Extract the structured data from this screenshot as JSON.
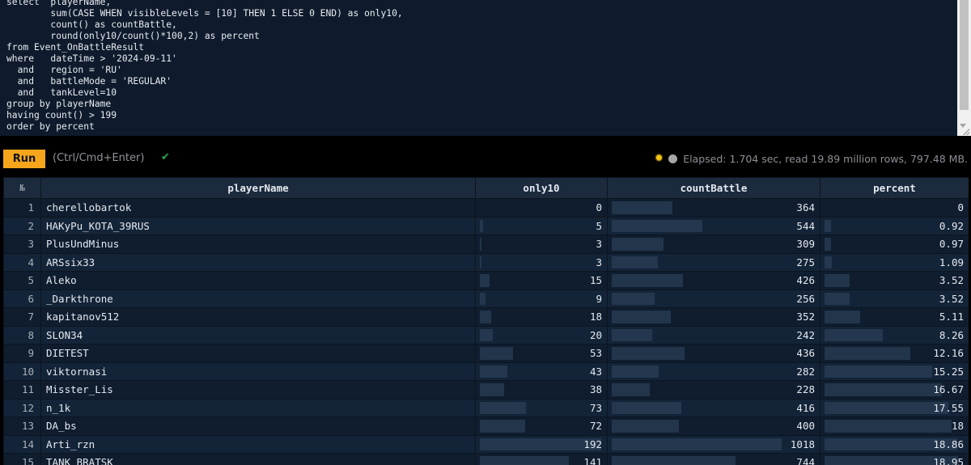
{
  "query": {
    "lines": [
      "select  playerName,",
      "        sum(CASE WHEN visibleLevels = [10] THEN 1 ELSE 0 END) as only10,",
      "        count() as countBattle,",
      "        round(only10/count()*100,2) as percent",
      "from Event_OnBattleResult",
      "where   dateTime > '2024-09-11'",
      "  and   region = 'RU'",
      "  and   battleMode = 'REGULAR'",
      "  and   tankLevel=10",
      "group by playerName",
      "having count() > 199",
      "order by percent"
    ]
  },
  "toolbar": {
    "run_label": "Run",
    "shortcut_hint": "(Ctrl/Cmd+Enter)",
    "check_icon": "checkmark-icon",
    "status_text": "Elapsed: 1.704 sec, read 19.89 million rows, 797.48 MB."
  },
  "icons": {
    "sun": "sun-icon",
    "dot": "status-dot-icon",
    "check": "checkmark-icon"
  },
  "colors": {
    "run_button": "#f7a61c",
    "check": "#2fa84f",
    "sun": "#f2c30f"
  },
  "results": {
    "columns": [
      "№",
      "playerName",
      "only10",
      "countBattle",
      "percent"
    ],
    "rows": [
      {
        "n": "1",
        "playerName": "cherellobartok",
        "only10": "0",
        "countBattle": "364",
        "percent": "0"
      },
      {
        "n": "2",
        "playerName": "HAKyPu_KOTA_39RUS",
        "only10": "5",
        "countBattle": "544",
        "percent": "0.92"
      },
      {
        "n": "3",
        "playerName": "PlusUndMinus",
        "only10": "3",
        "countBattle": "309",
        "percent": "0.97"
      },
      {
        "n": "4",
        "playerName": "ARSsix33",
        "only10": "3",
        "countBattle": "275",
        "percent": "1.09"
      },
      {
        "n": "5",
        "playerName": "Aleko",
        "only10": "15",
        "countBattle": "426",
        "percent": "3.52"
      },
      {
        "n": "6",
        "playerName": "_Darkthrone",
        "only10": "9",
        "countBattle": "256",
        "percent": "3.52"
      },
      {
        "n": "7",
        "playerName": "kapitanov512",
        "only10": "18",
        "countBattle": "352",
        "percent": "5.11"
      },
      {
        "n": "8",
        "playerName": "SLON34",
        "only10": "20",
        "countBattle": "242",
        "percent": "8.26"
      },
      {
        "n": "9",
        "playerName": "DIETEST",
        "only10": "53",
        "countBattle": "436",
        "percent": "12.16"
      },
      {
        "n": "10",
        "playerName": "viktornasi",
        "only10": "43",
        "countBattle": "282",
        "percent": "15.25"
      },
      {
        "n": "11",
        "playerName": "Misster_Lis",
        "only10": "38",
        "countBattle": "228",
        "percent": "16.67"
      },
      {
        "n": "12",
        "playerName": "n_1k",
        "only10": "73",
        "countBattle": "416",
        "percent": "17.55"
      },
      {
        "n": "13",
        "playerName": "DA_bs",
        "only10": "72",
        "countBattle": "400",
        "percent": "18"
      },
      {
        "n": "14",
        "playerName": "Arti_rzn",
        "only10": "192",
        "countBattle": "1018",
        "percent": "18.86"
      },
      {
        "n": "15",
        "playerName": "TANK_BRATSK",
        "only10": "141",
        "countBattle": "744",
        "percent": "18.95"
      }
    ]
  }
}
